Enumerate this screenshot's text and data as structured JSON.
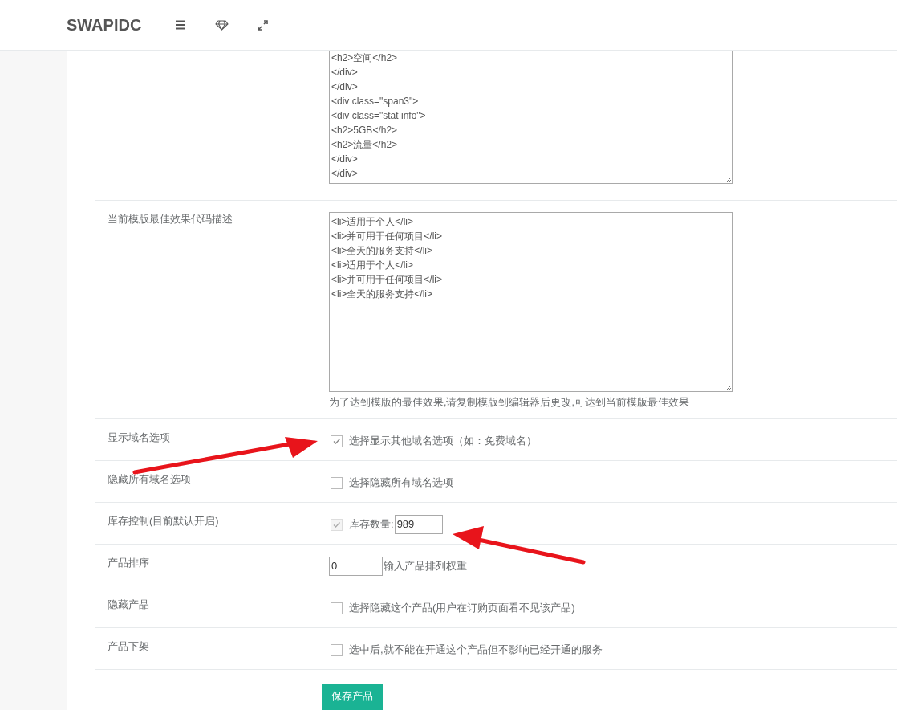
{
  "header": {
    "brand": "SWAPIDC"
  },
  "rows": [
    {
      "kind": "textarea",
      "lines": [
        "<h2>空间</h2>",
        "</div>",
        "</div>",
        "<div class=\"span3\">",
        "<div class=\"stat info\">",
        "<h2>5GB</h2>",
        "<h2>流量</h2>",
        "</div>",
        "</div>"
      ]
    },
    {
      "kind": "textarea",
      "label": "当前模版最佳效果代码描述",
      "lines": [
        "<li>适用于个人</li>",
        "<li>并可用于任何项目</li>",
        "<li>全天的服务支持</li>",
        "<li>适用于个人</li>",
        "<li>并可用于任何项目</li>",
        "<li>全天的服务支持</li>"
      ],
      "hint": "为了达到模版的最佳效果,请复制模版到编辑器后更改,可达到当前模版最佳效果"
    },
    {
      "kind": "checkbox",
      "label": "显示域名选项",
      "checked": true,
      "disabled": false,
      "text": "选择显示其他域名选项（如：免费域名）"
    },
    {
      "kind": "checkbox",
      "label": "隐藏所有域名选项",
      "checked": false,
      "disabled": false,
      "text": "选择隐藏所有域名选项"
    },
    {
      "kind": "checkbox_input",
      "label": "库存控制(目前默认开启)",
      "checked": true,
      "disabled": true,
      "text": "库存数量:",
      "value": "989"
    },
    {
      "kind": "input",
      "label": "产品排序",
      "value": "0",
      "text": "输入产品排列权重"
    },
    {
      "kind": "checkbox",
      "label": "隐藏产品",
      "checked": false,
      "disabled": false,
      "text": "选择隐藏这个产品(用户在订购页面看不见该产品)"
    },
    {
      "kind": "checkbox",
      "label": "产品下架",
      "checked": false,
      "disabled": false,
      "text": "选中后,就不能在开通这个产品但不影响已经开通的服务"
    }
  ],
  "save_button": "保存产品"
}
